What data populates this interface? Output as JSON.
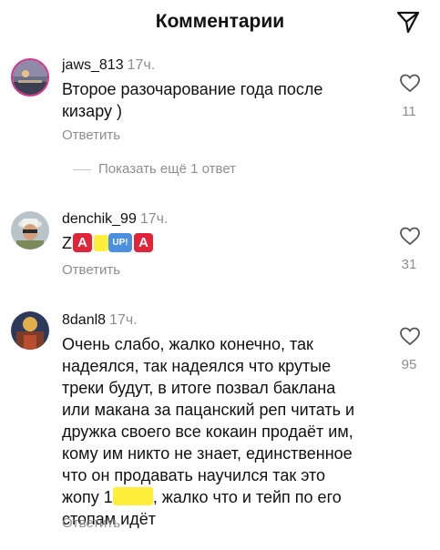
{
  "header": {
    "title": "Комментарии",
    "send_icon": "send-icon"
  },
  "colors": {
    "meta_gray": "#8e8e8e",
    "emoji_red": "#e0243a",
    "emoji_blue": "#4a8fe0",
    "marker_yellow": "#ffef3a"
  },
  "comments": [
    {
      "username": "jaws_813",
      "time": "17ч.",
      "text": "Второе разочарование года после кизару )",
      "reply_label": "Ответить",
      "likes": "11"
    },
    {
      "username": "denchik_99",
      "time": "17ч.",
      "emoji_text": {
        "z": "Z",
        "a1": "A",
        "up": "UP!",
        "a2": "A"
      },
      "reply_label": "Ответить",
      "likes": "31"
    },
    {
      "username": "8danl8",
      "time": "17ч.",
      "text_lines": [
        "Очень слабо, жалко конечно, так",
        "надеялся, так надеялся что крутые",
        "треки будут, в итоге позвал баклана",
        "или макана за пацанский реп читать и",
        "дружка своего все кокаин продаёт им,",
        "кому им никто не знает, единственное",
        "что он продавать научился так это"
      ],
      "line8_start": "жопу 1",
      "line8_end": ", жалко что и тейп по его",
      "line9": "стопам идёт",
      "reply_label": "Ответить",
      "likes": "95"
    }
  ],
  "show_more": {
    "label": "Показать ещё 1 ответ"
  }
}
